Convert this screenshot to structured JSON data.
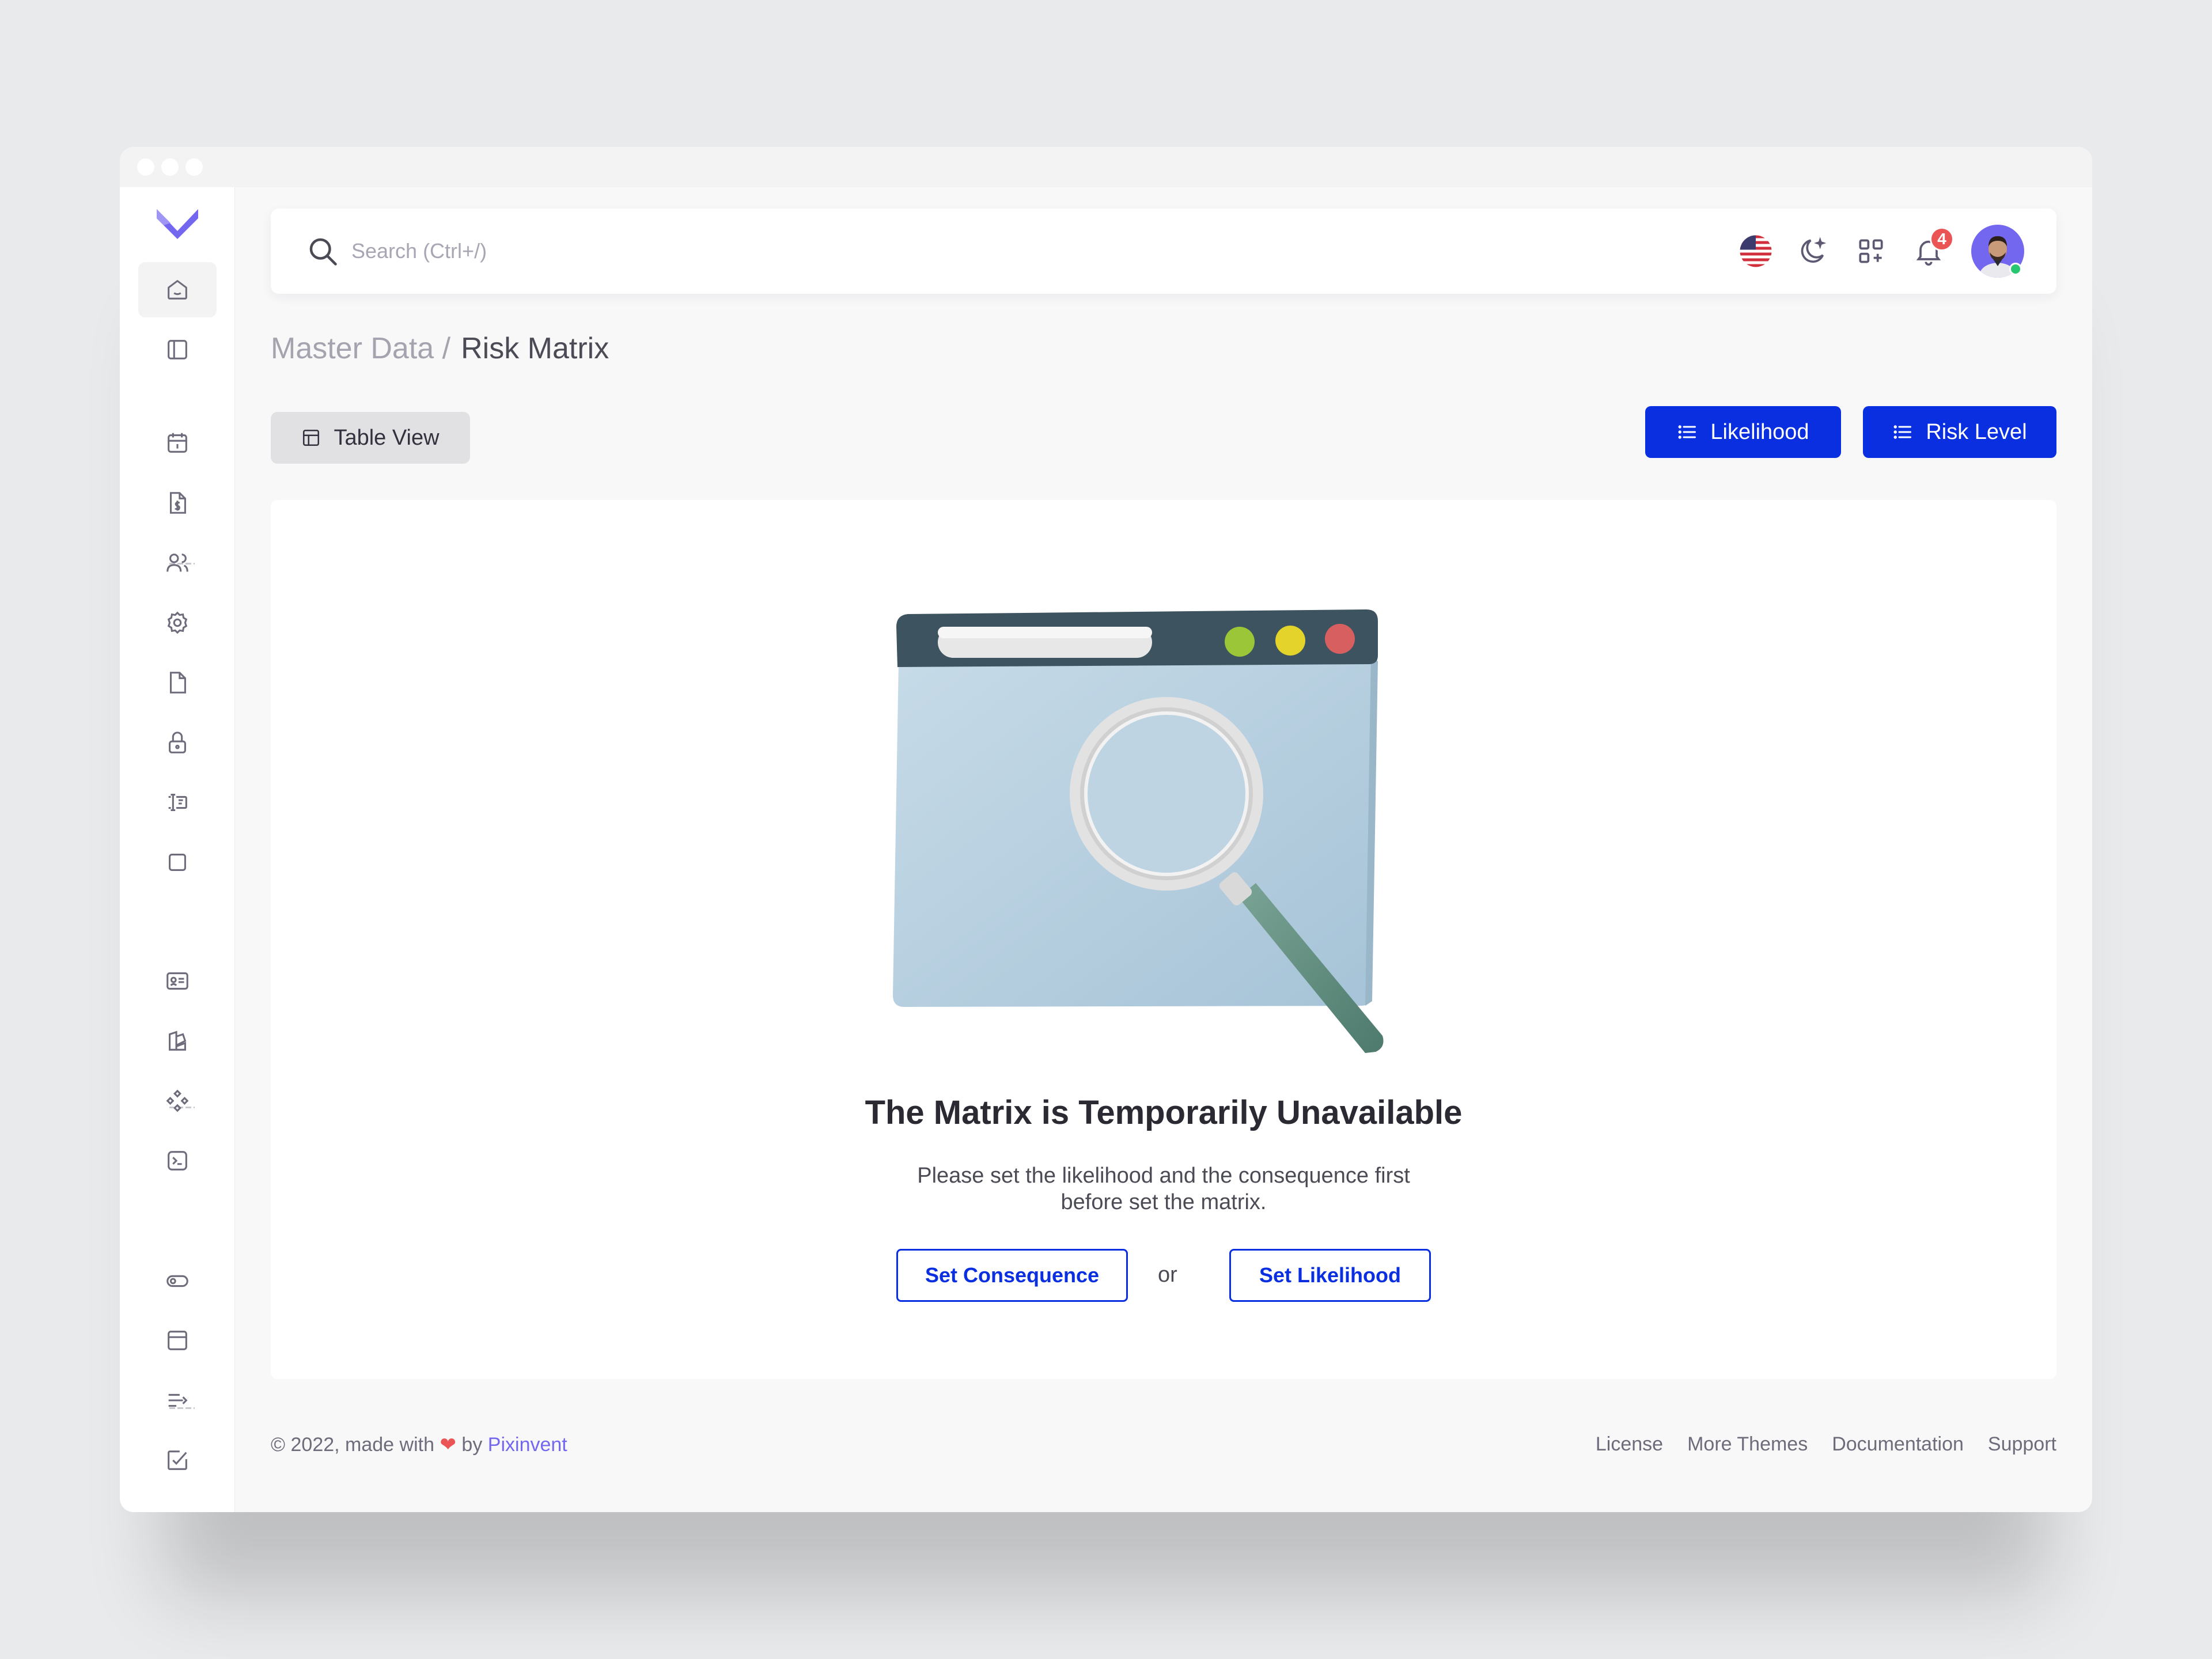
{
  "search": {
    "placeholder": "Search (Ctrl+/)"
  },
  "header": {
    "notification_count": "4"
  },
  "breadcrumb": {
    "parent": "Master Data /",
    "current": "Risk Matrix"
  },
  "toolbar": {
    "table_view_label": "Table View",
    "likelihood_label": "Likelihood",
    "risk_level_label": "Risk Level"
  },
  "empty_state": {
    "title": "The Matrix is Temporarily Unavailable",
    "description_line1": "Please set the likelihood and the consequence first",
    "description_line2": "before set the matrix.",
    "set_consequence_label": "Set Consequence",
    "or_label": "or",
    "set_likelihood_label": "Set Likelihood"
  },
  "footer": {
    "copyright_prefix": "© 2022, made with",
    "heart": "❤",
    "by": "by",
    "brand": "Pixinvent",
    "links": [
      "License",
      "More Themes",
      "Documentation",
      "Support"
    ]
  },
  "colors": {
    "primary": "#0a2fe0",
    "brand": "#7367f0",
    "danger": "#ea5455",
    "success": "#28c76f"
  },
  "sidebar": {
    "icons": [
      "home-icon",
      "layout-sidebar-icon",
      "calendar-icon",
      "invoice-icon",
      "users-icon",
      "settings-icon",
      "file-icon",
      "lock-icon",
      "text-cursor-icon",
      "square-icon",
      "id-card-icon",
      "shapes-icon",
      "components-icon",
      "terminal-icon",
      "toggle-icon",
      "window-icon",
      "align-arrow-icon",
      "checkbox-icon"
    ]
  }
}
